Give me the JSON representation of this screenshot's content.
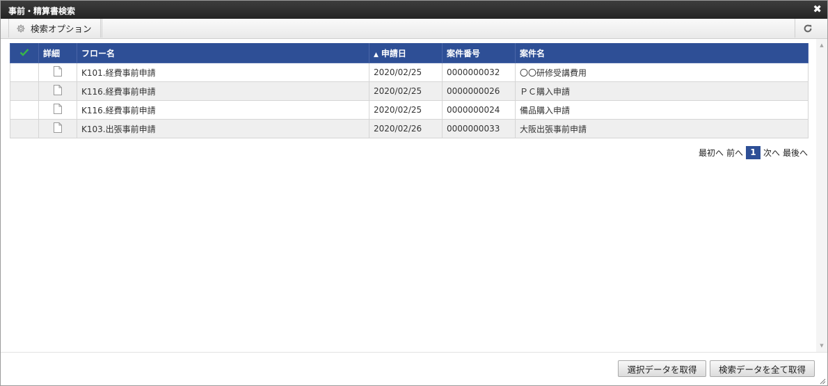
{
  "dialog": {
    "title": "事前・精算書検索",
    "close_symbol": "✖"
  },
  "toolbar": {
    "options_label": "検索オプション"
  },
  "table": {
    "columns": [
      {
        "label": ""
      },
      {
        "label": "詳細"
      },
      {
        "label": "フロー名"
      },
      {
        "label": "申請日",
        "sort": "▲"
      },
      {
        "label": "案件番号"
      },
      {
        "label": "案件名"
      }
    ],
    "rows": [
      {
        "flow": "K101.経費事前申請",
        "date": "2020/02/25",
        "number": "0000000032",
        "name": "〇〇研修受講費用"
      },
      {
        "flow": "K116.経費事前申請",
        "date": "2020/02/25",
        "number": "0000000026",
        "name": "ＰＣ購入申請"
      },
      {
        "flow": "K116.経費事前申請",
        "date": "2020/02/25",
        "number": "0000000024",
        "name": "備品購入申請"
      },
      {
        "flow": "K103.出張事前申請",
        "date": "2020/02/26",
        "number": "0000000033",
        "name": "大阪出張事前申請"
      }
    ]
  },
  "pager": {
    "first": "最初へ",
    "prev": "前へ",
    "current": "1",
    "next": "次へ",
    "last": "最後へ"
  },
  "footer": {
    "get_selected": "選択データを取得",
    "get_all": "検索データを全て取得"
  },
  "colors": {
    "header_bg": "#2e4f96",
    "check_green": "#39b54a"
  }
}
